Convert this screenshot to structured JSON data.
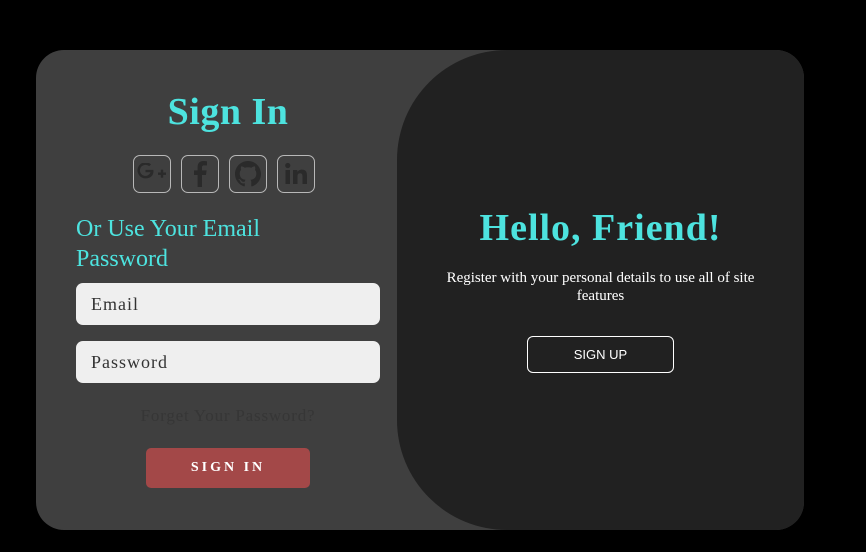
{
  "signin": {
    "title": "Sign In",
    "social_icons": [
      "google-plus-icon",
      "facebook-icon",
      "github-icon",
      "linkedin-icon"
    ],
    "alt_text": "Or Use Your Email Password",
    "email_placeholder": "Email",
    "password_placeholder": "Password",
    "forgot_link": "Forget Your Password?",
    "button_label": "SIGN IN"
  },
  "panel": {
    "title": "Hello, Friend!",
    "description": "Register with your personal details to use all of site features",
    "button_label": "SIGN UP"
  },
  "colors": {
    "accent": "#4de3df",
    "signin_button": "#a34848",
    "card_left": "#3f3f3f",
    "card_right": "#212121",
    "page_background": "#000000"
  }
}
